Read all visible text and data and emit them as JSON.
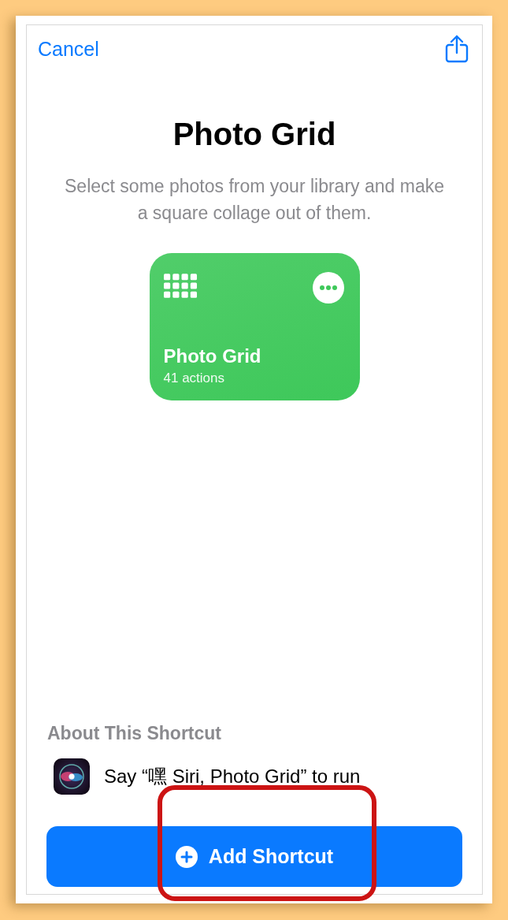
{
  "nav": {
    "cancel": "Cancel"
  },
  "title": "Photo Grid",
  "description": "Select some photos from your library and make a square collage out of them.",
  "shortcut_card": {
    "name": "Photo Grid",
    "subtitle": "41 actions",
    "color": "#3ec85a"
  },
  "about": {
    "heading": "About This Shortcut",
    "siri_phrase": "Say “嘿 Siri, Photo Grid” to run"
  },
  "add_button": {
    "label": "Add Shortcut",
    "highlighted": true
  }
}
